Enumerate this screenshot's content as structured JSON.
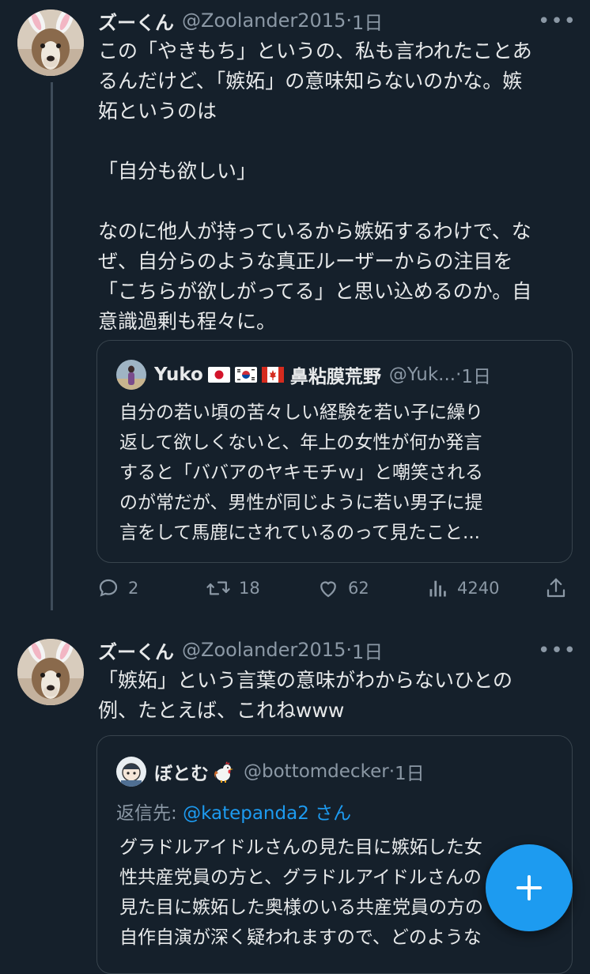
{
  "tweets": [
    {
      "name": "ズーくん",
      "handle": "@Zoolander2015",
      "sep": "·",
      "time": "1日",
      "more": "•••",
      "body": [
        "この「やきもち」というの、私も言われたことあ",
        "るんだけど、「嫉妬」の意味知らないのかな。嫉",
        "妬というのは",
        "",
        "「自分も欲しい」",
        "",
        "なのに他人が持っているから嫉妬するわけで、な",
        "ぜ、自分らのような真正ルーザーからの注目を",
        "「こちらが欲しがってる」と思い込めるのか。自",
        "意識過剰も程々に。"
      ],
      "quote": {
        "name": "Yuko",
        "flags": [
          "japan-flag",
          "korea-flag",
          "canada-flag"
        ],
        "name_suffix": "鼻粘膜荒野",
        "handle": "@Yuk...",
        "sep": "·",
        "time": "1日",
        "body": [
          "自分の若い頃の苦々しい経験を若い子に繰り",
          "返して欲しくないと、年上の女性が何か発言",
          "すると「ババアのヤキモチｗ」と嘲笑される",
          "のが常だが、男性が同じように若い男子に提",
          "言をして馬鹿にされているのって見たこと..."
        ]
      },
      "actions": {
        "replies": "2",
        "retweets": "18",
        "likes": "62",
        "views": "4240"
      }
    },
    {
      "name": "ズーくん",
      "handle": "@Zoolander2015",
      "sep": "·",
      "time": "1日",
      "more": "•••",
      "body": [
        "「嫉妬」という言葉の意味がわからないひとの",
        "例、たとえば、これねwww"
      ],
      "quote": {
        "name": "ぼとむ",
        "name_emoji": "rooster-emoji",
        "handle": "@bottomdecker",
        "sep": "·",
        "time": "1日",
        "replying_label": "返信先: ",
        "replying_mention": "@katepanda2",
        "replying_suffix": " さん",
        "body": [
          "グラドルアイドルさんの見た目に嫉妬した女",
          "性共産党員の方と、グラドルアイドルさんの",
          "見た目に嫉妬した奥様のいる共産党員の方の",
          "自作自演が深く疑われますので、どのような"
        ]
      }
    }
  ],
  "compose_button": "plus-icon",
  "colors": {
    "background": "#15202b",
    "text": "#e7e9ea",
    "secondary": "#8b98a5",
    "accent": "#1d9bf0",
    "border": "#38444d"
  }
}
